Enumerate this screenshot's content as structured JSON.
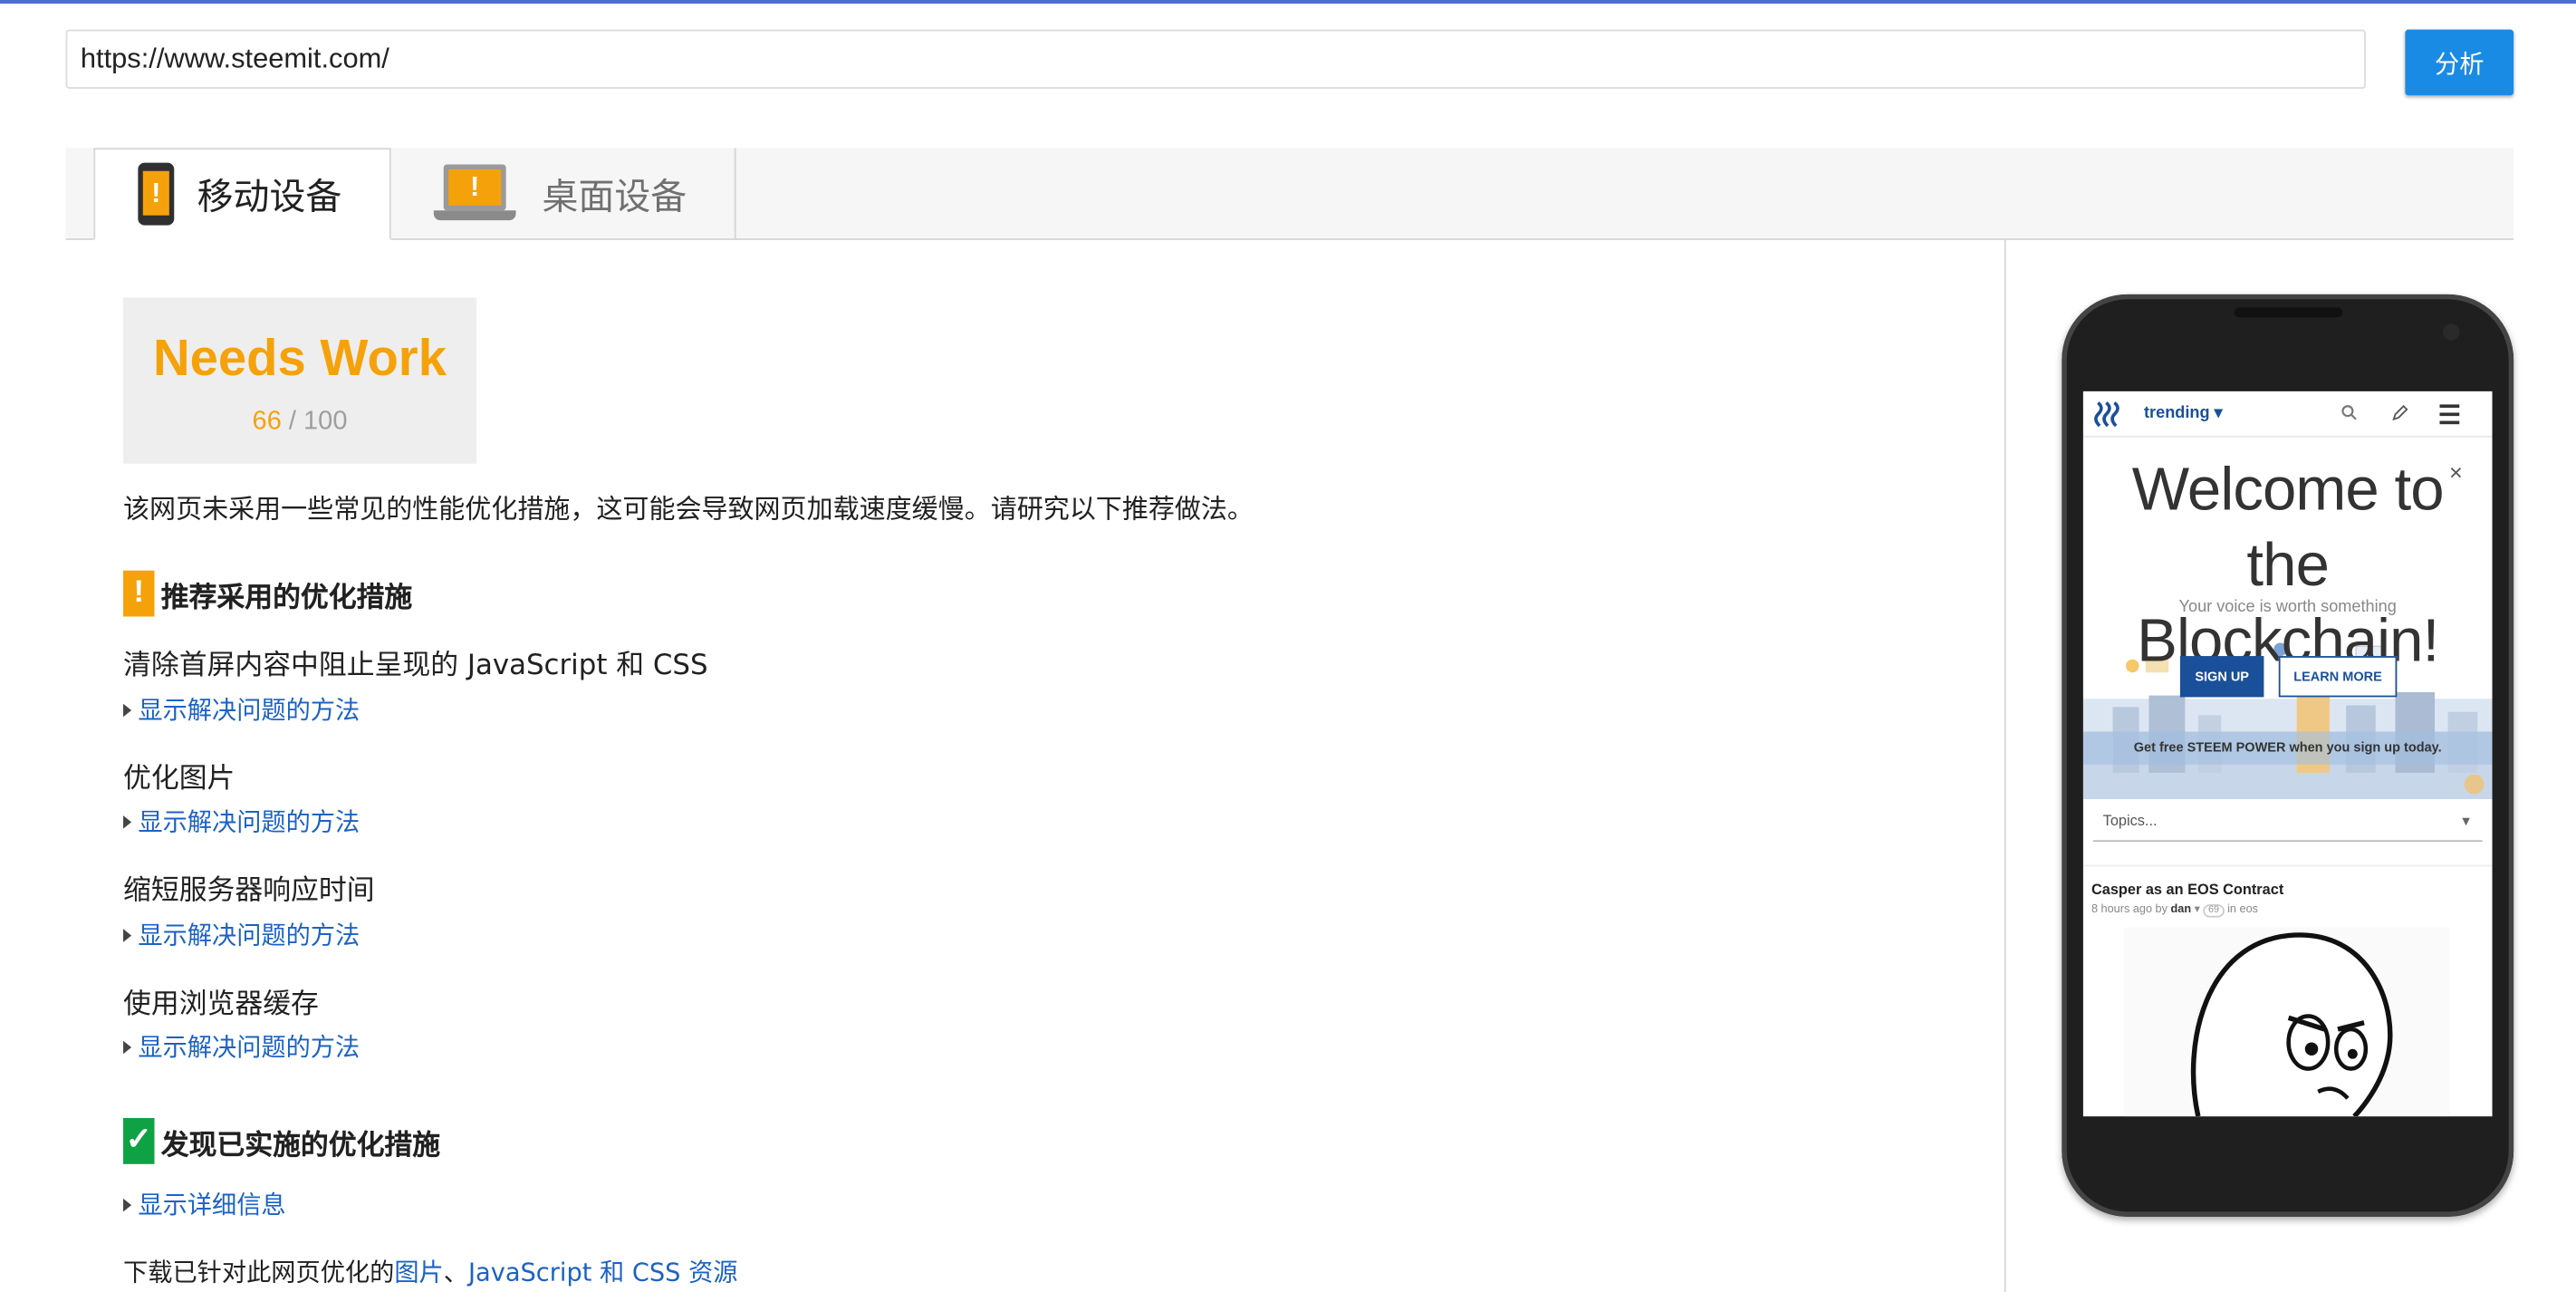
{
  "url_bar": {
    "value": "https://www.steemit.com/",
    "analyze_label": "分析"
  },
  "tabs": [
    {
      "label": "移动设备",
      "selected": true,
      "icon": "phone-warning-icon"
    },
    {
      "label": "桌面设备",
      "selected": false,
      "icon": "laptop-warning-icon"
    }
  ],
  "score": {
    "label": "Needs Work",
    "value": "66",
    "max": "100",
    "color": "#f5a20a"
  },
  "summary": "该网页未采用一些常见的性能优化措施，这可能会导致网页加载速度缓慢。请研究以下推荐做法。",
  "recommended": {
    "title": "推荐采用的优化措施",
    "badge": "!",
    "rules": [
      {
        "title": "清除首屏内容中阻止呈现的 JavaScript 和 CSS",
        "link": "显示解决问题的方法"
      },
      {
        "title": "优化图片",
        "link": "显示解决问题的方法"
      },
      {
        "title": "缩短服务器响应时间",
        "link": "显示解决问题的方法"
      },
      {
        "title": "使用浏览器缓存",
        "link": "显示解决问题的方法"
      }
    ]
  },
  "passed": {
    "title": "发现已实施的优化措施",
    "badge": "✓",
    "link": "显示详细信息"
  },
  "footer": {
    "prefix": "下载已针对此网页优化的",
    "link1": "图片",
    "sep": "、",
    "link2": "JavaScript 和 CSS 资源"
  },
  "preview": {
    "nav_label": "trending",
    "close": "×",
    "headline_line1": "Welcome to the",
    "headline_line2": "Blockchain!",
    "subheadline": "Your voice is worth something",
    "signup": "SIGN UP",
    "learn_more": "LEARN MORE",
    "promo": "Get free STEEM POWER when you sign up today.",
    "topics": "Topics...",
    "post_title": "Casper as an EOS Contract",
    "post_time": "8 hours ago by",
    "post_author": "dan",
    "post_rep": "69",
    "post_in": "in",
    "post_tag": "eos"
  },
  "colors": {
    "accent": "#1a8be5",
    "warning": "#f5a20a",
    "success": "#0ea245",
    "link": "#1c62c4"
  }
}
